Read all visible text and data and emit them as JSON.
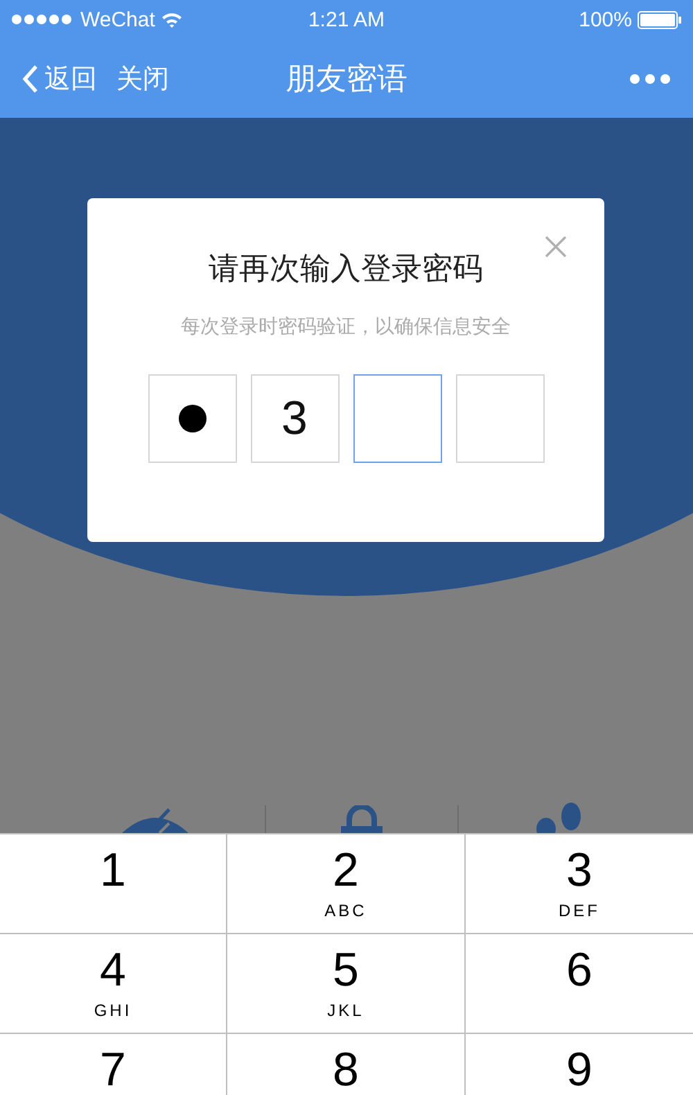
{
  "status_bar": {
    "carrier": "WeChat",
    "time": "1:21 AM",
    "battery": "100%"
  },
  "nav_bar": {
    "back": "返回",
    "close": "关闭",
    "title": "朋友密语"
  },
  "dialog": {
    "title": "请再次输入登录密码",
    "subtitle": "每次登录时密码验证，以确保信息安全",
    "pin_boxes": [
      {
        "kind": "masked",
        "focused": false
      },
      {
        "kind": "digit",
        "value": "3",
        "focused": false
      },
      {
        "kind": "empty",
        "focused": true
      },
      {
        "kind": "empty",
        "focused": false
      }
    ]
  },
  "keypad": [
    {
      "digit": "1"
    },
    {
      "digit": "2",
      "letters": "ABC"
    },
    {
      "digit": "3",
      "letters": "DEF"
    },
    {
      "digit": "4",
      "letters": "GHI"
    },
    {
      "digit": "5",
      "letters": "JKL"
    },
    {
      "digit": "6"
    },
    {
      "digit": "7"
    },
    {
      "digit": "8"
    },
    {
      "digit": "9"
    }
  ]
}
